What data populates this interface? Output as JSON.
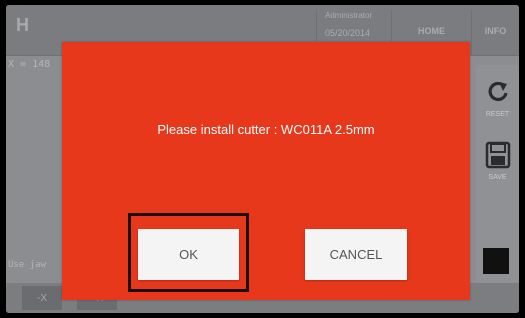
{
  "header": {
    "logo": "H",
    "user": "Administrator",
    "date": "05/20/2014",
    "home_label": "HOME",
    "info_label": "INFO"
  },
  "workspace": {
    "coord_readout": "X = 148",
    "jaw_label": "Use jaw"
  },
  "side_panel": {
    "reset_label": "RESET",
    "save_label": "SAVE"
  },
  "bottom_bar": {
    "minus_x": "-X",
    "plus_x": "+X"
  },
  "dialog": {
    "message": "Please install cutter : WC011A 2.5mm",
    "ok_label": "OK",
    "cancel_label": "CANCEL",
    "background_color": "#e8381c",
    "highlight_color": "#1a0f0e"
  },
  "icons": {
    "reset": "reset-arrow-icon",
    "save": "floppy-disk-icon"
  }
}
